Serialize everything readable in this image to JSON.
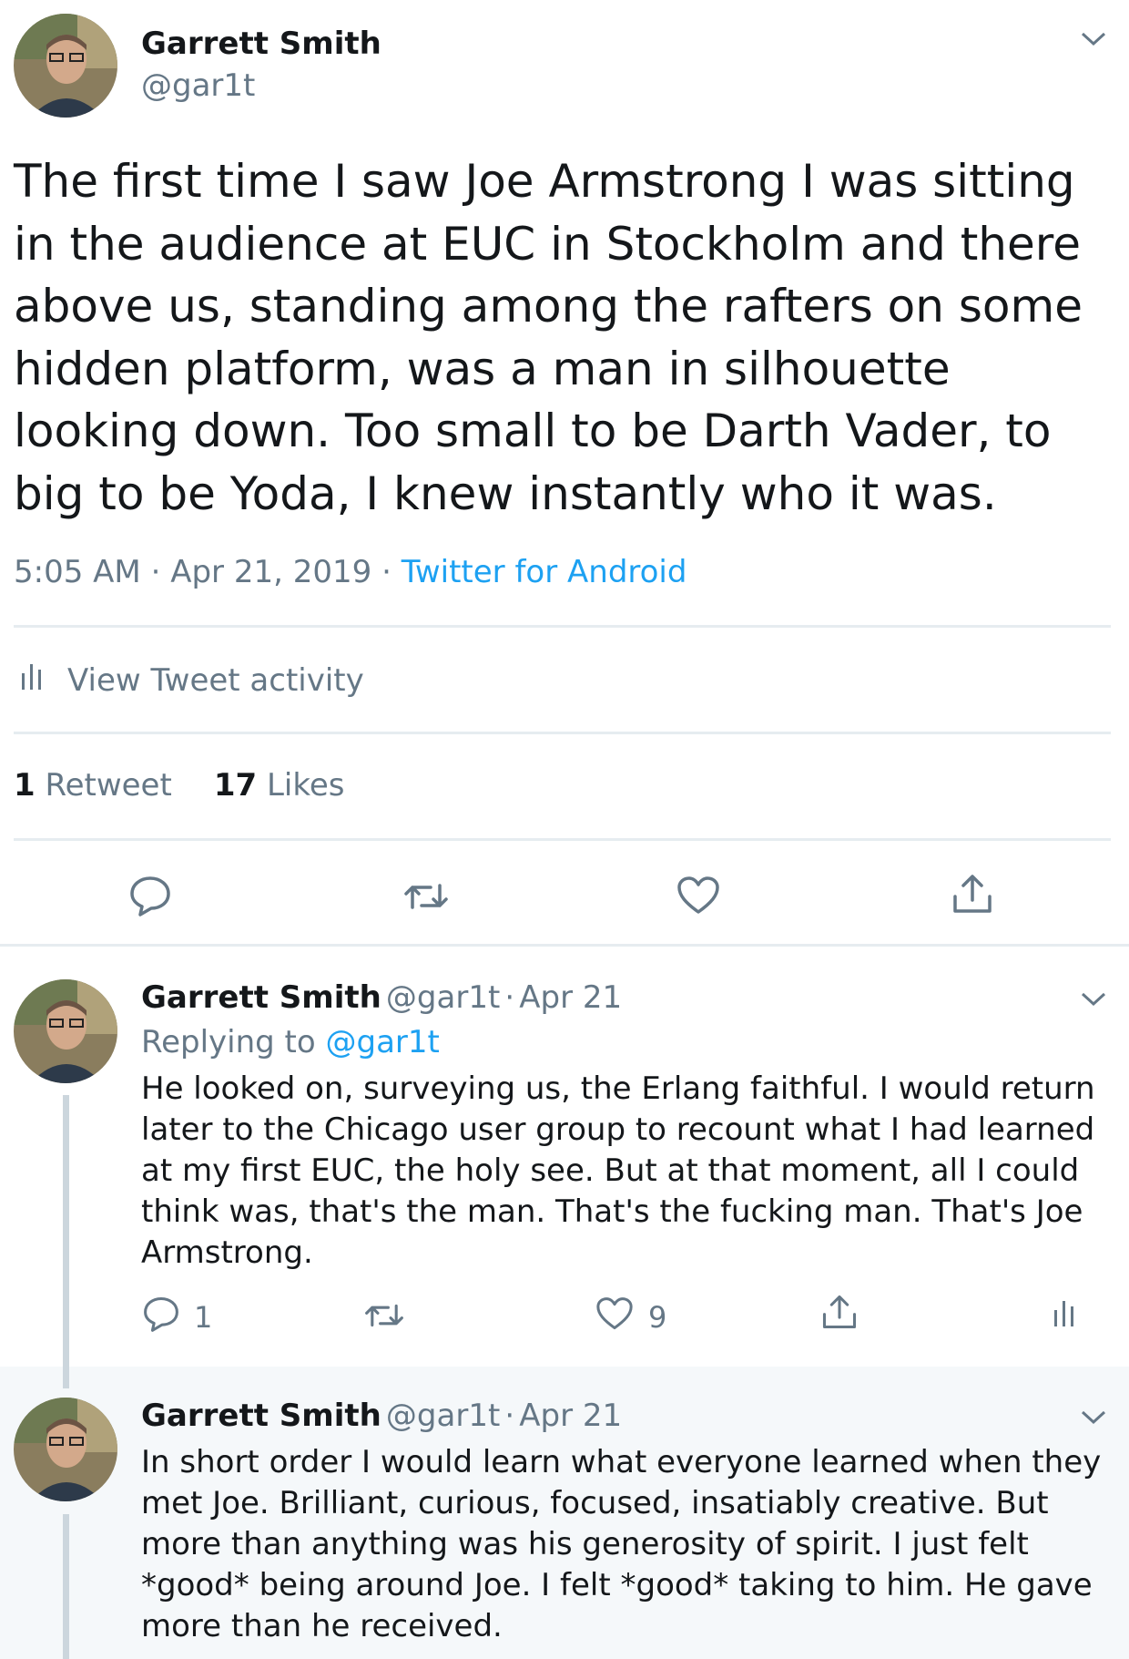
{
  "main_tweet": {
    "author_name": "Garrett Smith",
    "author_handle": "@gar1t",
    "text": "The first time I saw Joe Armstrong I was sitting in the audience at EUC in Stockholm and there above us, standing among the rafters on some hidden platform, was a man in silhouette looking down. Too small to be Darth Vader, to big to be Yoda, I knew instantly who it was.",
    "time": "5:05 AM",
    "date": "Apr 21, 2019",
    "source": "Twitter for Android",
    "separator": "·",
    "activity_label": "View Tweet activity",
    "retweet_count": "1",
    "retweet_label": "Retweet",
    "like_count": "17",
    "like_label": "Likes"
  },
  "replies": [
    {
      "author_name": "Garrett Smith",
      "author_handle": "@gar1t",
      "date": "Apr 21",
      "replying_prefix": "Replying to",
      "replying_handle": "@gar1t",
      "text": "He looked on, surveying us, the Erlang faithful. I would return later to the Chicago user group to recount what I had learned at my first EUC, the holy see. But at that moment, all I could think was, that's the man. That's the fucking man. That's Joe Armstrong.",
      "reply_count": "1",
      "like_count": "9"
    },
    {
      "author_name": "Garrett Smith",
      "author_handle": "@gar1t",
      "date": "Apr 21",
      "text": "In short order I would learn what everyone learned when they met Joe. Brilliant, curious, focused, insatiably creative. But more than anything was his generosity of spirit. I just felt *good* being around Joe. I felt *good* taking to him. He gave more than he received."
    }
  ],
  "colors": {
    "text": "#14171a",
    "secondary": "#657786",
    "link": "#1da1f2",
    "divider": "#e6ecf0",
    "highlight_bg": "#f5f8fa",
    "thread_line": "#ccd6dd"
  },
  "icons": [
    "avatar",
    "chevron-down-icon",
    "bar-chart-icon",
    "reply-icon",
    "retweet-icon",
    "like-icon",
    "share-icon",
    "analytics-icon"
  ]
}
